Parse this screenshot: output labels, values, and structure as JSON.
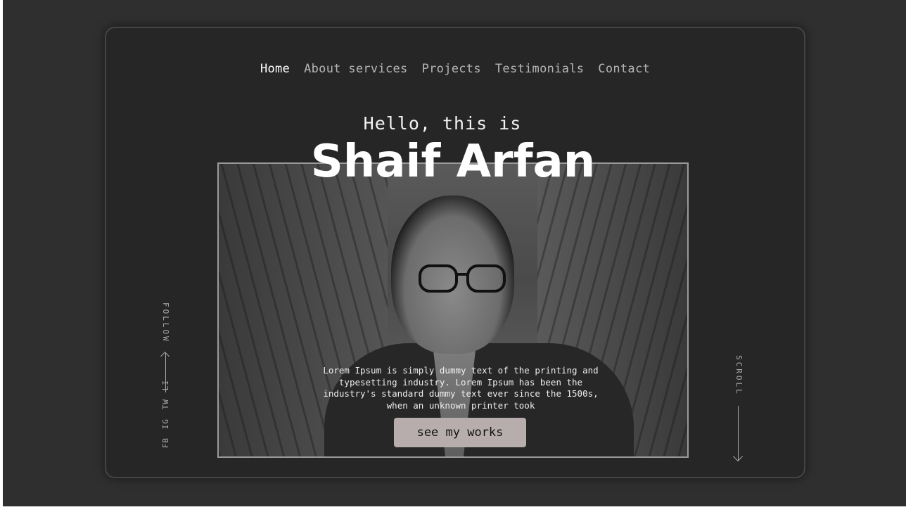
{
  "nav": {
    "items": [
      {
        "label": "Home",
        "active": true
      },
      {
        "label": "About services",
        "active": false
      },
      {
        "label": "Projects",
        "active": false
      },
      {
        "label": "Testimonials",
        "active": false
      },
      {
        "label": "Contact",
        "active": false
      }
    ]
  },
  "hero": {
    "greeting": "Hello, this is",
    "name": "Shaif Arfan",
    "description": "Lorem Ipsum is simply dummy text of the printing and typesetting industry. Lorem Ipsum has been the industry's standard dummy text ever since the 1500s, when an unknown printer took",
    "cta_label": "see my works"
  },
  "follow": {
    "label": "FOLLOW",
    "socials": [
      "LI",
      "TW",
      "IG",
      "FB"
    ]
  },
  "scroll": {
    "label": "SCROLL"
  },
  "colors": {
    "background": "#2f2f2f",
    "card": "#262626",
    "button": "#b7adad",
    "nav_active": "#ffffff",
    "nav_inactive": "#b5b5b5"
  },
  "icons": [
    "arrow-down-icon",
    "arrow-left-icon"
  ]
}
